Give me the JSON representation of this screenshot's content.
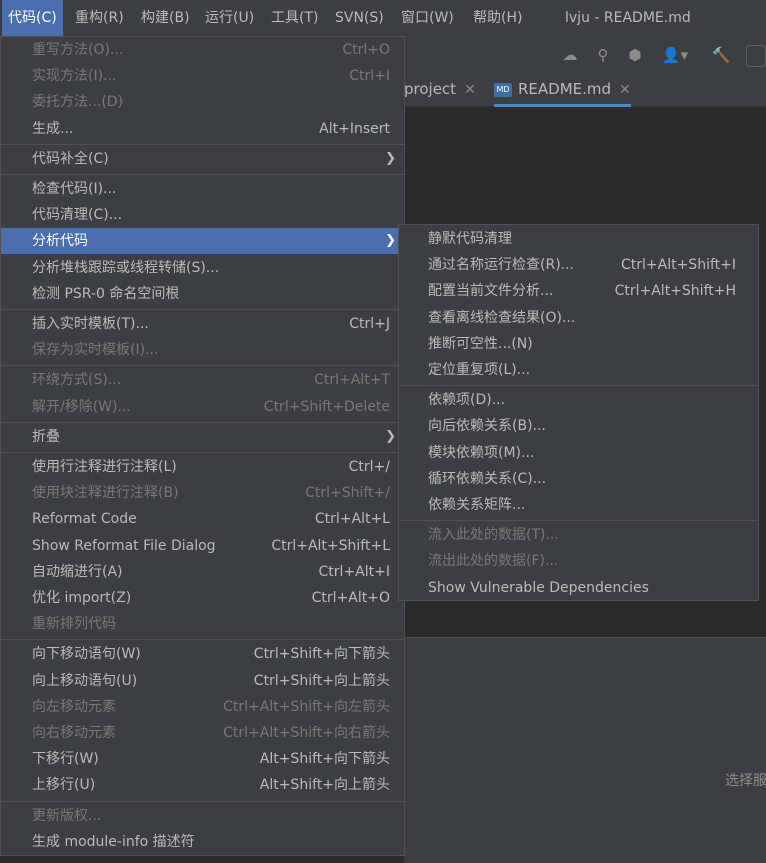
{
  "menubar": {
    "items": [
      "代码(C)",
      "重构(R)",
      "构建(B)",
      "运行(U)",
      "工具(T)",
      "SVN(S)",
      "窗口(W)",
      "帮助(H)"
    ],
    "window_title": "lvju - README.md"
  },
  "tabs": [
    {
      "label": "project"
    },
    {
      "label": "README.md",
      "icon": "MD"
    }
  ],
  "bottom_hint": "选择服",
  "code_menu": {
    "items": [
      {
        "label": "重写方法(O)...",
        "shortcut": "Ctrl+O",
        "enabled": false
      },
      {
        "label": "实现方法(I)...",
        "shortcut": "Ctrl+I",
        "enabled": false
      },
      {
        "label": "委托方法...(D)",
        "shortcut": "",
        "enabled": false
      },
      {
        "label": "生成...",
        "shortcut": "Alt+Insert",
        "enabled": true
      },
      {
        "label": "代码补全(C)",
        "shortcut": "",
        "enabled": true,
        "submenu": true
      },
      {
        "label": "检查代码(I)...",
        "shortcut": "",
        "enabled": true
      },
      {
        "label": "代码清理(C)...",
        "shortcut": "",
        "enabled": true
      },
      {
        "label": "分析代码",
        "shortcut": "",
        "enabled": true,
        "submenu": true,
        "selected": true
      },
      {
        "label": "分析堆栈跟踪或线程转储(S)...",
        "shortcut": "",
        "enabled": true
      },
      {
        "label": "检测 PSR-0 命名空间根",
        "shortcut": "",
        "enabled": true
      },
      {
        "label": "插入实时模板(T)...",
        "shortcut": "Ctrl+J",
        "enabled": true
      },
      {
        "label": "保存为实时模板(I)...",
        "shortcut": "",
        "enabled": false
      },
      {
        "label": "环绕方式(S)...",
        "shortcut": "Ctrl+Alt+T",
        "enabled": false
      },
      {
        "label": "解开/移除(W)...",
        "shortcut": "Ctrl+Shift+Delete",
        "enabled": false
      },
      {
        "label": "折叠",
        "shortcut": "",
        "enabled": true,
        "submenu": true
      },
      {
        "label": "使用行注释进行注释(L)",
        "shortcut": "Ctrl+/",
        "enabled": true
      },
      {
        "label": "使用块注释进行注释(B)",
        "shortcut": "Ctrl+Shift+/",
        "enabled": false
      },
      {
        "label": "Reformat Code",
        "shortcut": "Ctrl+Alt+L",
        "enabled": true
      },
      {
        "label": "Show Reformat File Dialog",
        "shortcut": "Ctrl+Alt+Shift+L",
        "enabled": true
      },
      {
        "label": "自动缩进行(A)",
        "shortcut": "Ctrl+Alt+I",
        "enabled": true
      },
      {
        "label": "优化 import(Z)",
        "shortcut": "Ctrl+Alt+O",
        "enabled": true
      },
      {
        "label": "重新排列代码",
        "shortcut": "",
        "enabled": false
      },
      {
        "label": "向下移动语句(W)",
        "shortcut": "Ctrl+Shift+向下箭头",
        "enabled": true
      },
      {
        "label": "向上移动语句(U)",
        "shortcut": "Ctrl+Shift+向上箭头",
        "enabled": true
      },
      {
        "label": "向左移动元素",
        "shortcut": "Ctrl+Alt+Shift+向左箭头",
        "enabled": false
      },
      {
        "label": "向右移动元素",
        "shortcut": "Ctrl+Alt+Shift+向右箭头",
        "enabled": false
      },
      {
        "label": "下移行(W)",
        "shortcut": "Alt+Shift+向下箭头",
        "enabled": true
      },
      {
        "label": "上移行(U)",
        "shortcut": "Alt+Shift+向上箭头",
        "enabled": true
      },
      {
        "label": "更新版权...",
        "shortcut": "",
        "enabled": false
      },
      {
        "label": "生成 module-info 描述符",
        "shortcut": "",
        "enabled": true
      }
    ]
  },
  "analyze_submenu": {
    "items": [
      {
        "label": "静默代码清理",
        "shortcut": "",
        "enabled": true
      },
      {
        "label": "通过名称运行检查(R)...",
        "shortcut": "Ctrl+Alt+Shift+I",
        "enabled": true
      },
      {
        "label": "配置当前文件分析...",
        "shortcut": "Ctrl+Alt+Shift+H",
        "enabled": true
      },
      {
        "label": "查看离线检查结果(O)...",
        "shortcut": "",
        "enabled": true
      },
      {
        "label": "推断可空性...(N)",
        "shortcut": "",
        "enabled": true
      },
      {
        "label": "定位重复项(L)...",
        "shortcut": "",
        "enabled": true
      },
      {
        "label": "依赖项(D)...",
        "shortcut": "",
        "enabled": true
      },
      {
        "label": "向后依赖关系(B)...",
        "shortcut": "",
        "enabled": true
      },
      {
        "label": "模块依赖项(M)...",
        "shortcut": "",
        "enabled": true
      },
      {
        "label": "循环依赖关系(C)...",
        "shortcut": "",
        "enabled": true
      },
      {
        "label": "依赖关系矩阵...",
        "shortcut": "",
        "enabled": true
      },
      {
        "label": "流入此处的数据(T)...",
        "shortcut": "",
        "enabled": false
      },
      {
        "label": "流出此处的数据(F)...",
        "shortcut": "",
        "enabled": false
      },
      {
        "label": "Show Vulnerable Dependencies",
        "shortcut": "",
        "enabled": true
      }
    ]
  }
}
